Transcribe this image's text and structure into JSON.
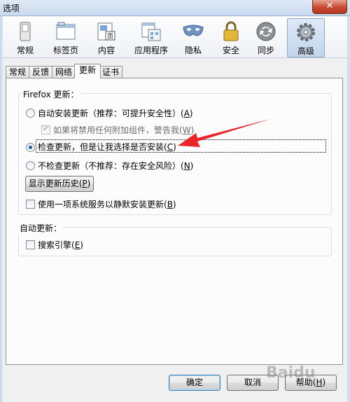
{
  "window": {
    "title": "选项",
    "close_glyph": "✕"
  },
  "categories": [
    {
      "label": "常规",
      "icon": "switch-icon"
    },
    {
      "label": "标签页",
      "icon": "tabs-window-icon"
    },
    {
      "label": "内容",
      "icon": "page-content-icon"
    },
    {
      "label": "应用程序",
      "icon": "applications-icon"
    },
    {
      "label": "隐私",
      "icon": "mask-icon"
    },
    {
      "label": "安全",
      "icon": "padlock-icon"
    },
    {
      "label": "同步",
      "icon": "sync-icon"
    },
    {
      "label": "高级",
      "icon": "gear-icon",
      "selected": true
    }
  ],
  "tabs": [
    "常规",
    "反馈",
    "网络",
    "更新",
    "证书"
  ],
  "active_tab": "更新",
  "firefox_update": {
    "title": "Firefox 更新：",
    "auto_install": {
      "label": "自动安装更新（推荐：可提升安全性）(",
      "key": "A",
      "end": ")"
    },
    "warn_addons": {
      "label": "如果将禁用任何附加组件，警告我(",
      "key": "W",
      "end": ")"
    },
    "check_choose": {
      "label": "检查更新，但是让我选择是否安装(",
      "key": "C",
      "end": ")"
    },
    "never_check": {
      "label": "不检查更新（不推荐：存在安全风险）(",
      "key": "N",
      "end": ")"
    },
    "history_button": {
      "label": "显示更新历史(",
      "key": "P",
      "end": ")"
    },
    "background_service": {
      "label": "使用一项系统服务以静默安装更新(",
      "key": "B",
      "end": ")"
    }
  },
  "auto_update": {
    "title": "自动更新：",
    "search_engines": {
      "label": "搜索引擎(",
      "key": "E",
      "end": ")"
    }
  },
  "buttons": {
    "ok": "确定",
    "cancel": "取消",
    "help": {
      "label": "帮助(",
      "key": "H",
      "end": ")"
    }
  },
  "watermark": "Baidu",
  "colors": {
    "arrow": "#e8262a",
    "selected_category": "#c3d5ec",
    "radio_dot": "#1d5aa8"
  }
}
